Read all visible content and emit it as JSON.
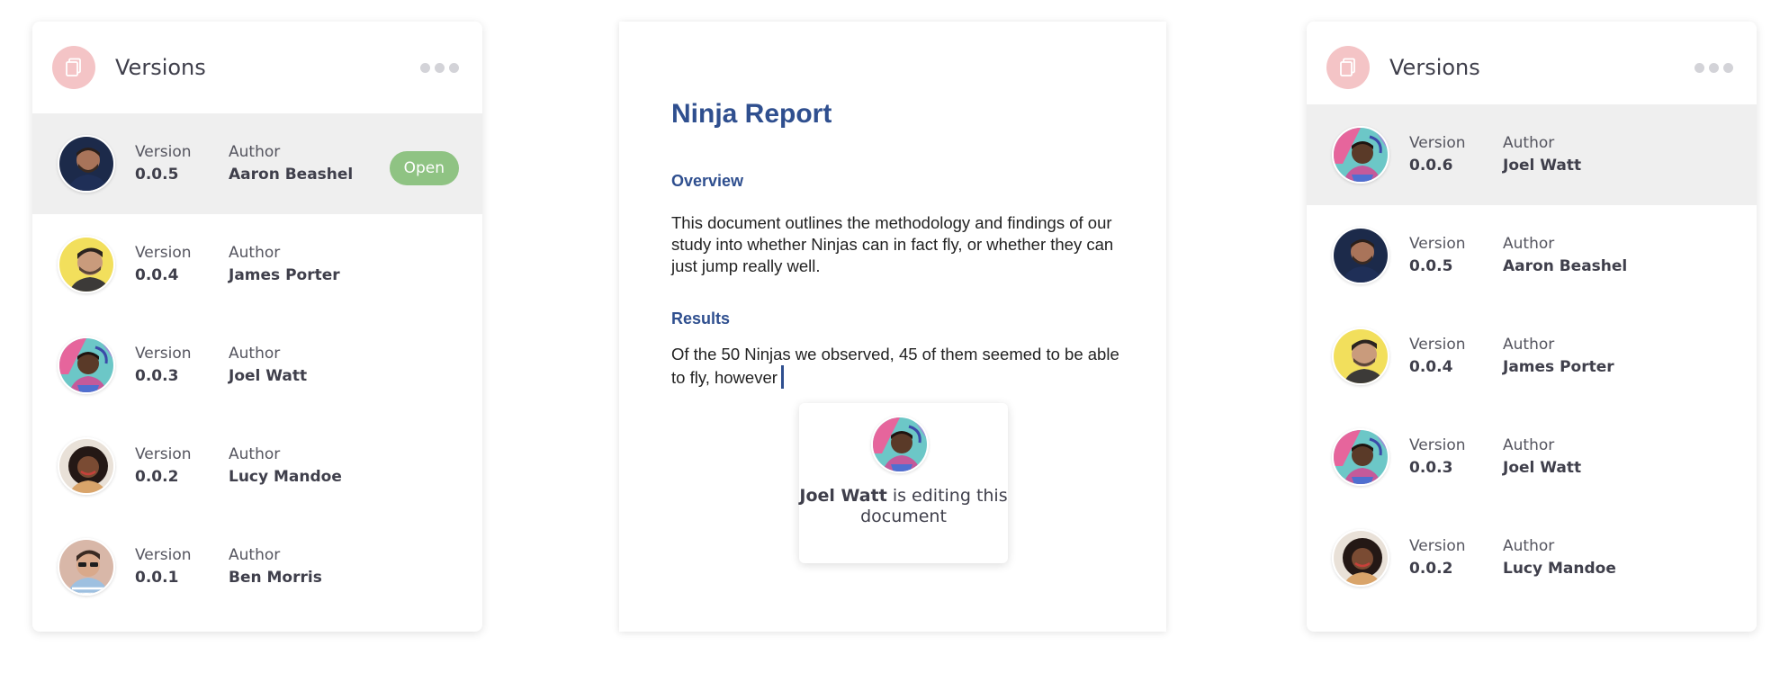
{
  "left_panel": {
    "title": "Versions",
    "icon": "document-icon",
    "menu_icon": "more-dots-icon",
    "open_label": "Open",
    "rows": [
      {
        "version_label": "Version",
        "version": "0.0.5",
        "author_label": "Author",
        "author": "Aaron Beashel",
        "avatar": "aaron"
      },
      {
        "version_label": "Version",
        "version": "0.0.4",
        "author_label": "Author",
        "author": "James Porter",
        "avatar": "james"
      },
      {
        "version_label": "Version",
        "version": "0.0.3",
        "author_label": "Author",
        "author": "Joel Watt",
        "avatar": "joel"
      },
      {
        "version_label": "Version",
        "version": "0.0.2",
        "author_label": "Author",
        "author": "Lucy Mandoe",
        "avatar": "lucy"
      },
      {
        "version_label": "Version",
        "version": "0.0.1",
        "author_label": "Author",
        "author": "Ben Morris",
        "avatar": "ben"
      }
    ]
  },
  "document": {
    "title": "Ninja Report",
    "overview_heading": "Overview",
    "overview_text": "This document outlines the methodology and findings of our study into whether Ninjas can in fact fly, or whether they can just jump really well.",
    "results_heading": "Results",
    "results_text": "Of the 50 Ninjas we observed, 45 of them seemed to be able to fly, however",
    "editor_name": "Joel Watt",
    "editor_status": "is editing this document"
  },
  "right_panel": {
    "title": "Versions",
    "icon": "document-icon",
    "menu_icon": "more-dots-icon",
    "rows": [
      {
        "version_label": "Version",
        "version": "0.0.6",
        "author_label": "Author",
        "author": "Joel Watt",
        "avatar": "joel"
      },
      {
        "version_label": "Version",
        "version": "0.0.5",
        "author_label": "Author",
        "author": "Aaron Beashel",
        "avatar": "aaron"
      },
      {
        "version_label": "Version",
        "version": "0.0.4",
        "author_label": "Author",
        "author": "James Porter",
        "avatar": "james"
      },
      {
        "version_label": "Version",
        "version": "0.0.3",
        "author_label": "Author",
        "author": "Joel Watt",
        "avatar": "joel"
      },
      {
        "version_label": "Version",
        "version": "0.0.2",
        "author_label": "Author",
        "author": "Lucy Mandoe",
        "avatar": "lucy"
      }
    ]
  },
  "colors": {
    "accent_pink": "#f4c4c6",
    "open_green": "#8fc383",
    "doc_blue": "#2f4f8f",
    "active_row": "#efefef"
  }
}
